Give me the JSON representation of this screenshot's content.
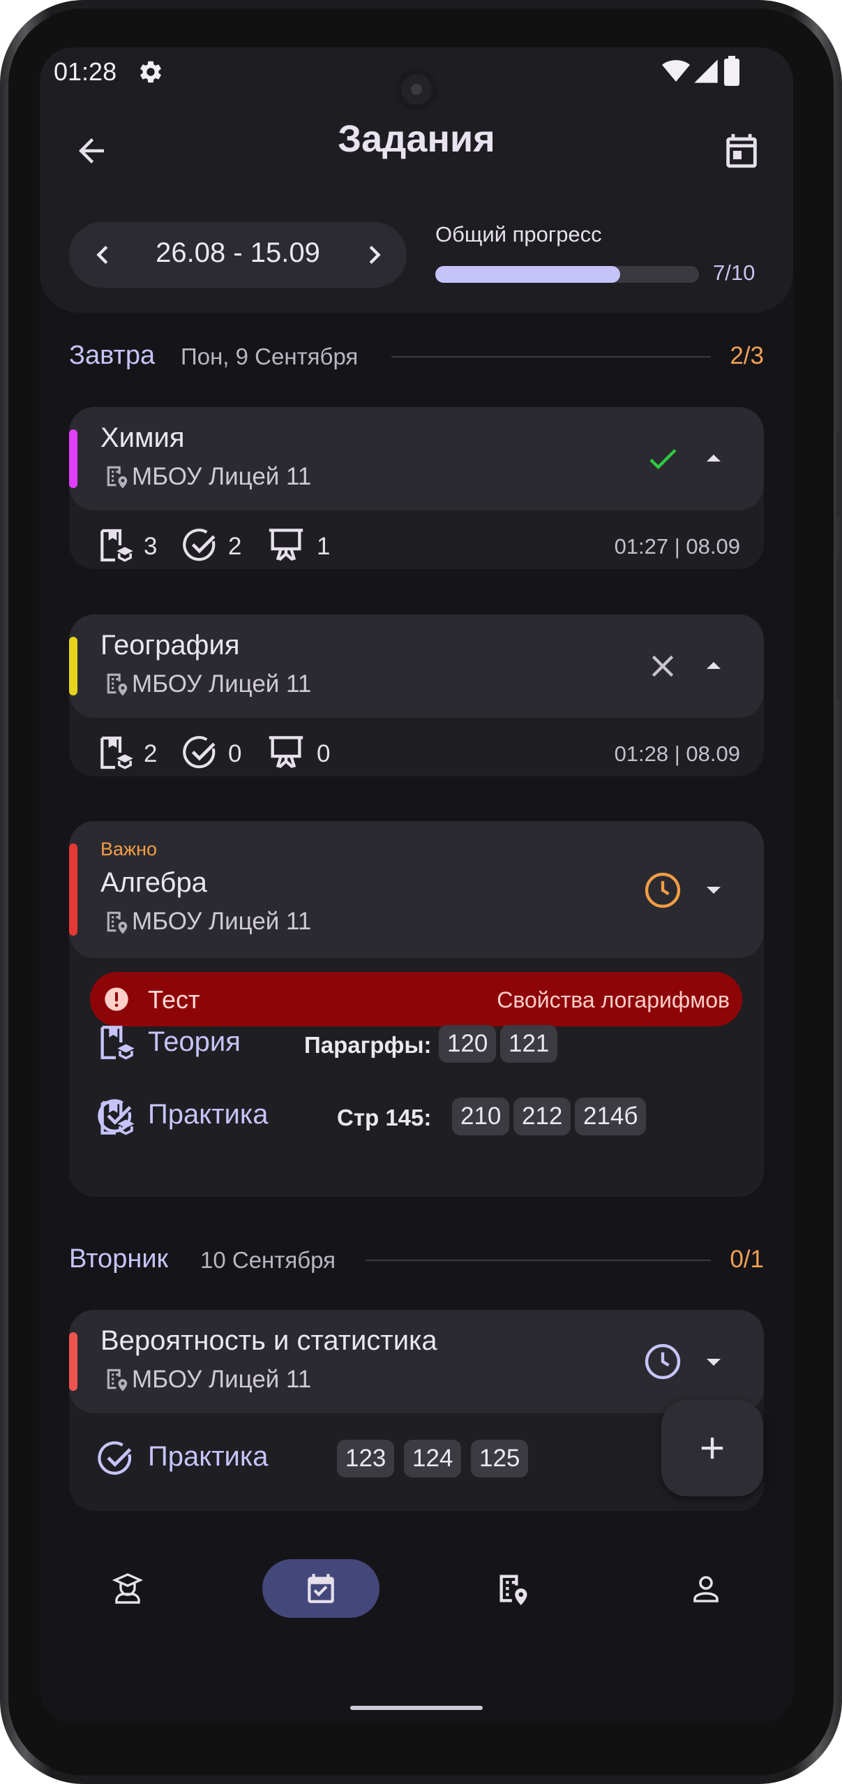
{
  "status_bar": {
    "time": "01:28"
  },
  "header": {
    "title": "Задания"
  },
  "date_range": {
    "label": "26.08 - 15.09"
  },
  "progress": {
    "label": "Общий прогресс",
    "count": "7/10",
    "fraction": 0.7
  },
  "days": [
    {
      "name": "Завтра",
      "date": "Пон, 9 Сентября",
      "count": "2/3"
    },
    {
      "name": "Вторник",
      "date": "10 Сентября",
      "count": "0/1"
    }
  ],
  "cards": [
    {
      "subject": "Химия",
      "school": "МБОУ Лицей 11",
      "accent": "#e040fb",
      "status_icon": "check-icon",
      "theory": "3",
      "practice": "2",
      "presentation": "1",
      "time": "01:27 | 08.09"
    },
    {
      "subject": "География",
      "school": "МБОУ Лицей 11",
      "accent": "#e5d41b",
      "status_icon": "close-icon",
      "theory": "2",
      "practice": "0",
      "presentation": "0",
      "time": "01:28 | 08.09"
    },
    {
      "tag": "Важно",
      "subject": "Алгебра",
      "school": "МБОУ Лицей 11",
      "accent": "#e53935",
      "status_icon": "clock-icon",
      "test": {
        "label": "Тест",
        "topic": "Свойства логарифмов"
      },
      "theory": {
        "label": "Теория",
        "desc": "Парагрфы:",
        "chips": [
          "120",
          "121"
        ]
      },
      "practice": {
        "label": "Практика",
        "desc": "Стр 145:",
        "chips": [
          "210",
          "212",
          "214б"
        ]
      }
    },
    {
      "subject": "Вероятность и статистика",
      "school": "МБОУ Лицей 11",
      "accent": "#ef5350",
      "status_icon": "clock-icon",
      "practice": {
        "label": "Практика",
        "chips": [
          "123",
          "124",
          "125"
        ]
      }
    }
  ],
  "fab": {
    "icon": "plus-icon"
  },
  "bottom_nav": [
    {
      "icon": "student-icon",
      "active": false
    },
    {
      "icon": "calendar-check-icon",
      "active": true
    },
    {
      "icon": "building-location-icon",
      "active": false
    },
    {
      "icon": "person-icon",
      "active": false
    }
  ],
  "colors": {
    "background": "#151418",
    "surface": "#1f1e23",
    "accent": "#c6c4f8",
    "count": "#f2a057",
    "success": "#2ecc40",
    "test": "#8e0508"
  }
}
